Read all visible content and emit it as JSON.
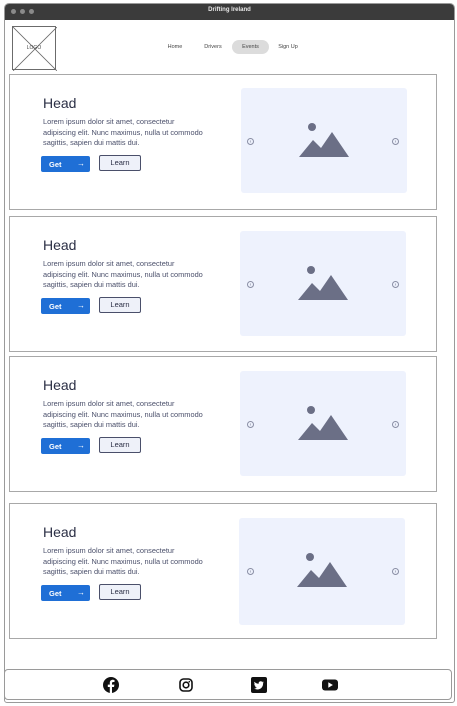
{
  "window": {
    "title": "Drifting Ireland"
  },
  "logo": {
    "text": "LOGO"
  },
  "nav": {
    "items": [
      {
        "label": "Home",
        "active": false
      },
      {
        "label": "Drivers",
        "active": false
      },
      {
        "label": "Events",
        "active": true
      },
      {
        "label": "Sign Up",
        "active": false
      }
    ]
  },
  "cards": [
    {
      "heading": "Head",
      "body": "Lorem ipsum dolor sit amet, consectetur adipiscing elit. Nunc maximus, nulla ut commodo sagittis, sapien dui mattis dui.",
      "primary_label": "Get",
      "secondary_label": "Learn"
    },
    {
      "heading": "Head",
      "body": "Lorem ipsum dolor sit amet, consectetur adipiscing elit. Nunc maximus, nulla ut commodo sagittis, sapien dui mattis dui.",
      "primary_label": "Get",
      "secondary_label": "Learn"
    },
    {
      "heading": "Head",
      "body": "Lorem ipsum dolor sit amet, consectetur adipiscing elit. Nunc maximus, nulla ut commodo sagittis, sapien dui mattis dui.",
      "primary_label": "Get",
      "secondary_label": "Learn"
    },
    {
      "heading": "Head",
      "body": "Lorem ipsum dolor sit amet, consectetur adipiscing elit. Nunc maximus, nulla ut commodo sagittis, sapien dui mattis dui.",
      "primary_label": "Get",
      "secondary_label": "Learn"
    }
  ],
  "footer": {
    "social_icons": [
      "facebook-icon",
      "instagram-icon",
      "twitter-icon",
      "youtube-icon"
    ]
  },
  "colors": {
    "primary_button": "#1f6fd6",
    "media_background": "#eef2fd",
    "image_placeholder": "#6b6f86",
    "nav_active": "#dcdcdc"
  }
}
